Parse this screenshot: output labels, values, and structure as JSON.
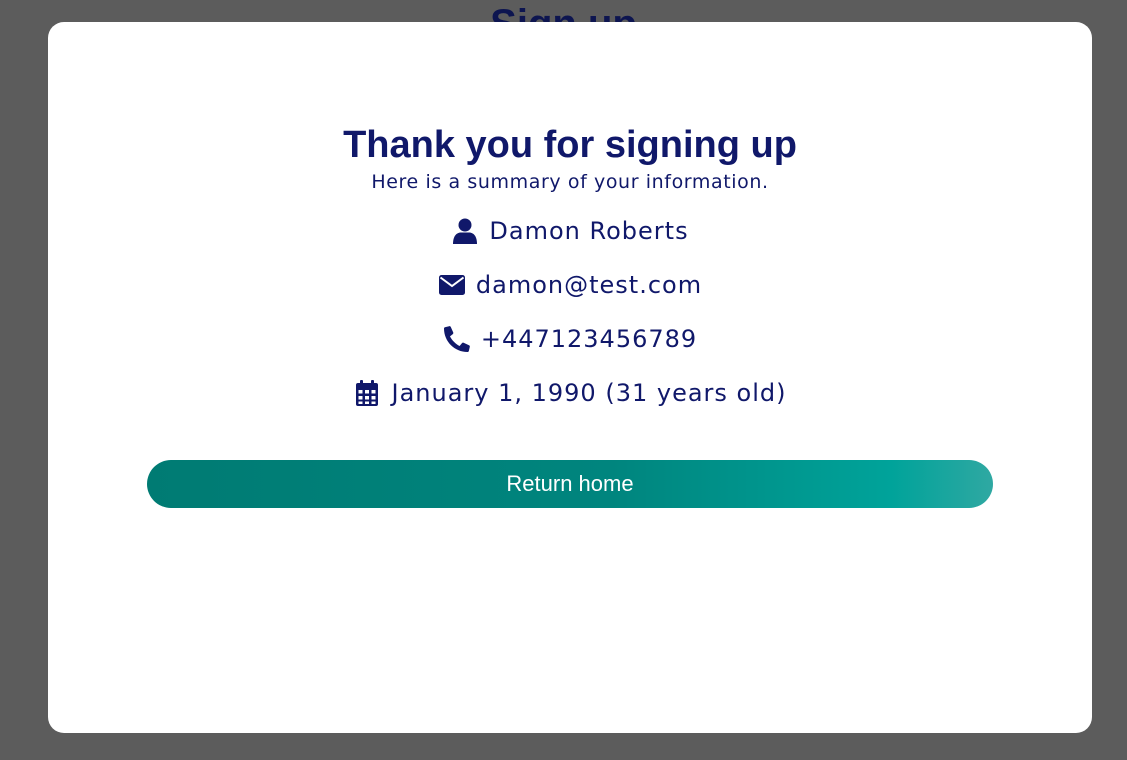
{
  "background": {
    "title": "Sign up"
  },
  "modal": {
    "title": "Thank you for signing up",
    "subtitle": "Here is a summary of your information.",
    "info": {
      "name": {
        "icon": "user-icon",
        "text": "Damon Roberts"
      },
      "email": {
        "icon": "envelope-icon",
        "text": "damon@test.com"
      },
      "phone": {
        "icon": "phone-icon",
        "text": "+447123456789"
      },
      "dob": {
        "icon": "calendar-icon",
        "text": "January 1, 1990 (31 years old)"
      }
    },
    "return_button_label": "Return home"
  },
  "colors": {
    "overlay": "#5c5c5c",
    "text_primary": "#10186a",
    "button_gradient_start": "#007b73",
    "button_gradient_end": "#2fa8a2"
  }
}
